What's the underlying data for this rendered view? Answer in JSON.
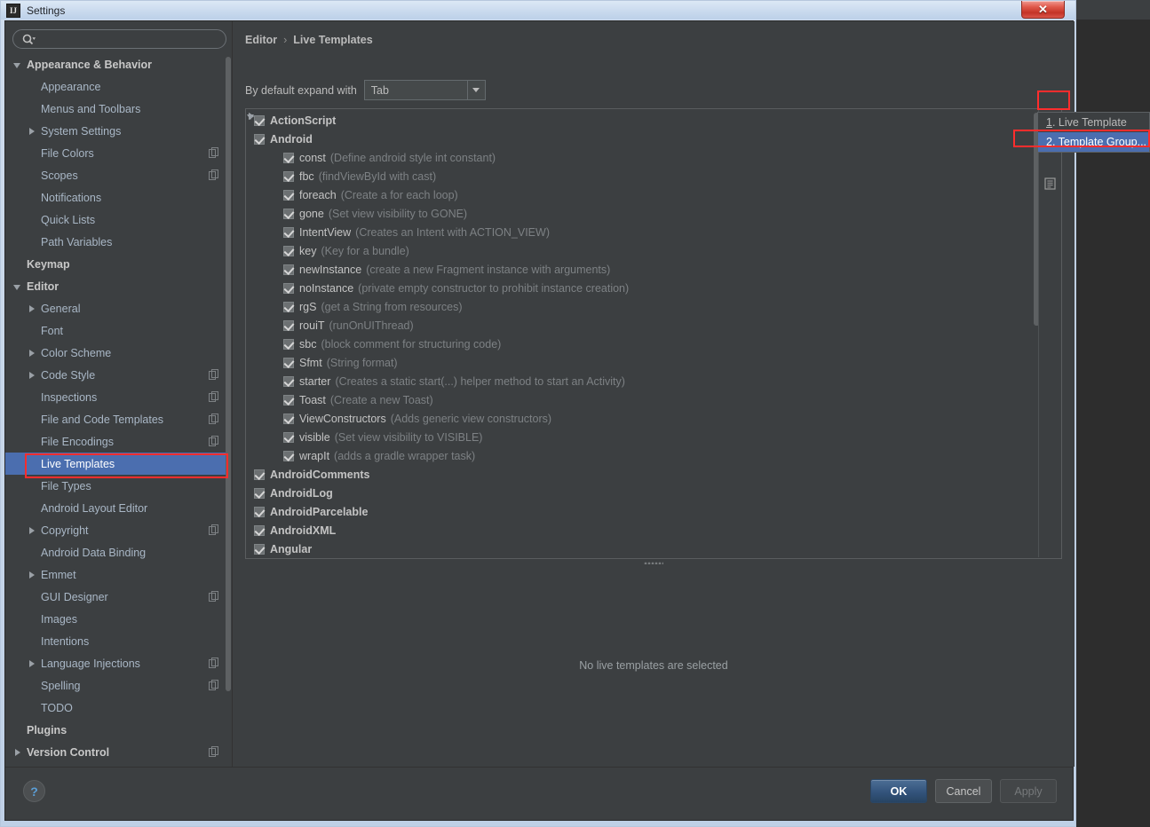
{
  "window": {
    "title": "Settings",
    "app_icon": "IJ",
    "close_label": "✕"
  },
  "sidebar": {
    "search": {
      "placeholder": "",
      "value": "",
      "icon": "search-icon"
    },
    "items": [
      {
        "label": "Appearance & Behavior",
        "level": 0,
        "arrow": "down",
        "bold": true,
        "badge": false
      },
      {
        "label": "Appearance",
        "level": 1,
        "arrow": "none",
        "bold": false,
        "badge": false
      },
      {
        "label": "Menus and Toolbars",
        "level": 1,
        "arrow": "none",
        "bold": false,
        "badge": false
      },
      {
        "label": "System Settings",
        "level": 1,
        "arrow": "right",
        "bold": false,
        "badge": false
      },
      {
        "label": "File Colors",
        "level": 1,
        "arrow": "none",
        "bold": false,
        "badge": true
      },
      {
        "label": "Scopes",
        "level": 1,
        "arrow": "none",
        "bold": false,
        "badge": true
      },
      {
        "label": "Notifications",
        "level": 1,
        "arrow": "none",
        "bold": false,
        "badge": false
      },
      {
        "label": "Quick Lists",
        "level": 1,
        "arrow": "none",
        "bold": false,
        "badge": false
      },
      {
        "label": "Path Variables",
        "level": 1,
        "arrow": "none",
        "bold": false,
        "badge": false
      },
      {
        "label": "Keymap",
        "level": 0,
        "arrow": "none",
        "bold": true,
        "badge": false
      },
      {
        "label": "Editor",
        "level": 0,
        "arrow": "down",
        "bold": true,
        "badge": false
      },
      {
        "label": "General",
        "level": 1,
        "arrow": "right",
        "bold": false,
        "badge": false
      },
      {
        "label": "Font",
        "level": 1,
        "arrow": "none",
        "bold": false,
        "badge": false
      },
      {
        "label": "Color Scheme",
        "level": 1,
        "arrow": "right",
        "bold": false,
        "badge": false
      },
      {
        "label": "Code Style",
        "level": 1,
        "arrow": "right",
        "bold": false,
        "badge": true
      },
      {
        "label": "Inspections",
        "level": 1,
        "arrow": "none",
        "bold": false,
        "badge": true
      },
      {
        "label": "File and Code Templates",
        "level": 1,
        "arrow": "none",
        "bold": false,
        "badge": true
      },
      {
        "label": "File Encodings",
        "level": 1,
        "arrow": "none",
        "bold": false,
        "badge": true
      },
      {
        "label": "Live Templates",
        "level": 1,
        "arrow": "none",
        "bold": false,
        "badge": false,
        "selected": true
      },
      {
        "label": "File Types",
        "level": 1,
        "arrow": "none",
        "bold": false,
        "badge": false
      },
      {
        "label": "Android Layout Editor",
        "level": 1,
        "arrow": "none",
        "bold": false,
        "badge": false
      },
      {
        "label": "Copyright",
        "level": 1,
        "arrow": "right",
        "bold": false,
        "badge": true
      },
      {
        "label": "Android Data Binding",
        "level": 1,
        "arrow": "none",
        "bold": false,
        "badge": false
      },
      {
        "label": "Emmet",
        "level": 1,
        "arrow": "right",
        "bold": false,
        "badge": false
      },
      {
        "label": "GUI Designer",
        "level": 1,
        "arrow": "none",
        "bold": false,
        "badge": true
      },
      {
        "label": "Images",
        "level": 1,
        "arrow": "none",
        "bold": false,
        "badge": false
      },
      {
        "label": "Intentions",
        "level": 1,
        "arrow": "none",
        "bold": false,
        "badge": false
      },
      {
        "label": "Language Injections",
        "level": 1,
        "arrow": "right",
        "bold": false,
        "badge": true
      },
      {
        "label": "Spelling",
        "level": 1,
        "arrow": "none",
        "bold": false,
        "badge": true
      },
      {
        "label": "TODO",
        "level": 1,
        "arrow": "none",
        "bold": false,
        "badge": false
      },
      {
        "label": "Plugins",
        "level": 0,
        "arrow": "none",
        "bold": true,
        "badge": false
      },
      {
        "label": "Version Control",
        "level": 0,
        "arrow": "right",
        "bold": true,
        "badge": true
      }
    ]
  },
  "main": {
    "breadcrumb": {
      "parent": "Editor",
      "separator": "›",
      "current": "Live Templates"
    },
    "expand_with": {
      "label": "By default expand with",
      "value": "Tab"
    },
    "empty_message": "No live templates are selected",
    "toolbar": {
      "add_icon": "plus-icon",
      "copy_icon": "document-icon"
    },
    "tree": [
      {
        "type": "group",
        "name": "ActionScript",
        "arrow": "right",
        "checked": true
      },
      {
        "type": "group",
        "name": "Android",
        "arrow": "down",
        "checked": true
      },
      {
        "type": "template",
        "name": "const",
        "desc": "(Define android style int constant)",
        "checked": true
      },
      {
        "type": "template",
        "name": "fbc",
        "desc": "(findViewById with cast)",
        "checked": true
      },
      {
        "type": "template",
        "name": "foreach",
        "desc": "(Create a for each loop)",
        "checked": true
      },
      {
        "type": "template",
        "name": "gone",
        "desc": "(Set view visibility to GONE)",
        "checked": true
      },
      {
        "type": "template",
        "name": "IntentView",
        "desc": "(Creates an Intent with ACTION_VIEW)",
        "checked": true
      },
      {
        "type": "template",
        "name": "key",
        "desc": "(Key for a bundle)",
        "checked": true
      },
      {
        "type": "template",
        "name": "newInstance",
        "desc": "(create a new Fragment instance with arguments)",
        "checked": true
      },
      {
        "type": "template",
        "name": "noInstance",
        "desc": "(private empty constructor to prohibit instance creation)",
        "checked": true
      },
      {
        "type": "template",
        "name": "rgS",
        "desc": "(get a String from resources)",
        "checked": true
      },
      {
        "type": "template",
        "name": "rouiT",
        "desc": "(runOnUIThread)",
        "checked": true
      },
      {
        "type": "template",
        "name": "sbc",
        "desc": "(block comment for structuring code)",
        "checked": true
      },
      {
        "type": "template",
        "name": "Sfmt",
        "desc": "(String format)",
        "checked": true
      },
      {
        "type": "template",
        "name": "starter",
        "desc": "(Creates a static start(...) helper method to start an Activity)",
        "checked": true
      },
      {
        "type": "template",
        "name": "Toast",
        "desc": "(Create a new Toast)",
        "checked": true
      },
      {
        "type": "template",
        "name": "ViewConstructors",
        "desc": "(Adds generic view constructors)",
        "checked": true
      },
      {
        "type": "template",
        "name": "visible",
        "desc": "(Set view visibility to VISIBLE)",
        "checked": true
      },
      {
        "type": "template",
        "name": "wrapIt",
        "desc": "(adds a gradle wrapper task)",
        "checked": true
      },
      {
        "type": "group",
        "name": "AndroidComments",
        "arrow": "right",
        "checked": true
      },
      {
        "type": "group",
        "name": "AndroidLog",
        "arrow": "right",
        "checked": true
      },
      {
        "type": "group",
        "name": "AndroidParcelable",
        "arrow": "right",
        "checked": true
      },
      {
        "type": "group",
        "name": "AndroidXML",
        "arrow": "right",
        "checked": true
      },
      {
        "type": "group",
        "name": "Angular",
        "arrow": "right",
        "checked": true
      }
    ]
  },
  "popup": {
    "items": [
      {
        "mnemonic": "1",
        "label": ". Live Template",
        "active": false
      },
      {
        "mnemonic": "2",
        "label": ". Template Group...",
        "active": true
      }
    ]
  },
  "footer": {
    "help_label": "?",
    "ok_label": "OK",
    "cancel_label": "Cancel",
    "apply_label": "Apply"
  },
  "colors": {
    "accent_selection": "#4b6eaf",
    "panel_bg": "#3c3f41",
    "annotation_red": "#ff2d2d",
    "plus_green": "#62c462"
  }
}
